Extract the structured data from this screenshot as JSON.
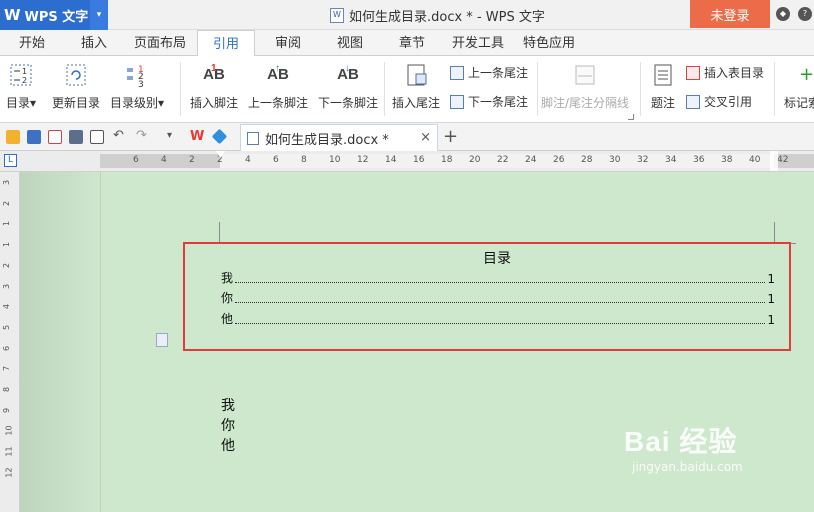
{
  "app": {
    "name": "WPS 文字",
    "logo_glyph": "W",
    "menu_arrow": "▾"
  },
  "window": {
    "title": "如何生成目录.docx * - WPS 文字",
    "login_label": "未登录",
    "skin_icon": "skin-icon",
    "help_icon": "help-icon"
  },
  "tabs": [
    {
      "label": "开始"
    },
    {
      "label": "插入"
    },
    {
      "label": "页面布局"
    },
    {
      "label": "引用",
      "active": true
    },
    {
      "label": "审阅"
    },
    {
      "label": "视图"
    },
    {
      "label": "章节"
    },
    {
      "label": "开发工具"
    },
    {
      "label": "特色应用"
    }
  ],
  "ribbon": {
    "toc": "目录",
    "update_toc": "更新目录",
    "toc_level": "目录级别",
    "insert_footnote": "插入脚注",
    "prev_footnote": "上一条脚注",
    "next_footnote": "下一条脚注",
    "insert_endnote": "插入尾注",
    "prev_endnote": "上一条尾注",
    "next_endnote": "下一条尾注",
    "note_separator": "脚注/尾注分隔线",
    "caption": "题注",
    "insert_table_of_figures": "插入表目录",
    "cross_reference": "交叉引用",
    "mark_index": "标记索",
    "ab_glyph": "AB",
    "sup_glyph": "1",
    "dropdown_glyph": "▾"
  },
  "quickbar": {
    "doc_tab": "如何生成目录.docx *",
    "close_glyph": "×",
    "new_tab_glyph": "+",
    "more_glyph": "▾"
  },
  "hruler": {
    "ticks": [
      "6",
      "4",
      "2",
      "2",
      "4",
      "6",
      "8",
      "10",
      "12",
      "14",
      "16",
      "18",
      "20",
      "22",
      "24",
      "26",
      "28",
      "30",
      "32",
      "34",
      "36",
      "38",
      "40",
      "42"
    ]
  },
  "vruler": {
    "ticks": [
      "3",
      "2",
      "1",
      "1",
      "2",
      "3",
      "4",
      "5",
      "6",
      "7",
      "8",
      "9",
      "10",
      "11",
      "12"
    ]
  },
  "toc": {
    "title": "目录",
    "entries": [
      {
        "text": "我",
        "page": "1"
      },
      {
        "text": "你",
        "page": "1"
      },
      {
        "text": "他",
        "page": "1"
      }
    ]
  },
  "body": {
    "lines": [
      "我",
      "你",
      "他"
    ]
  },
  "watermark": {
    "main": "Bai 经验",
    "sub": "jingyan.baidu.com"
  },
  "colors": {
    "accent": "#2b6dd6",
    "login": "#ec6c4a",
    "highlight_box": "#e23b3b",
    "page_bg": "#cde8cd"
  }
}
